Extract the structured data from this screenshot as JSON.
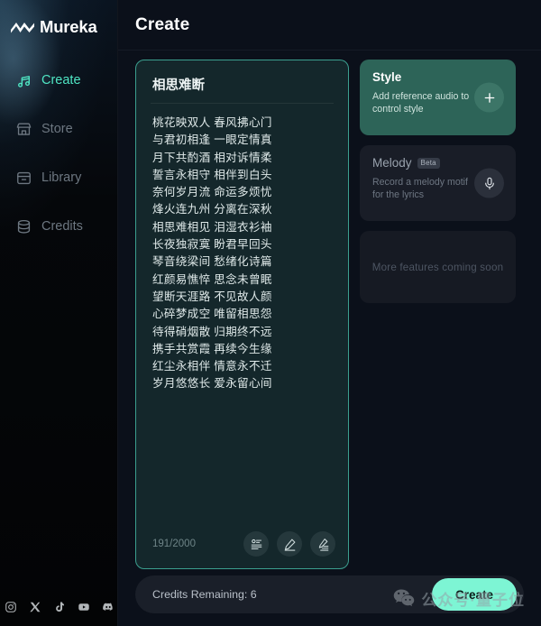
{
  "sidebar": {
    "logo": {
      "text": "Mureka",
      "icon": "wave-logo-icon"
    },
    "items": [
      {
        "label": "Create",
        "icon": "music-note-icon",
        "active": true
      },
      {
        "label": "Store",
        "icon": "storefront-icon",
        "active": false
      },
      {
        "label": "Library",
        "icon": "archive-box-icon",
        "active": false
      },
      {
        "label": "Credits",
        "icon": "database-coins-icon",
        "active": false
      }
    ],
    "socials": [
      {
        "name": "instagram-icon"
      },
      {
        "name": "x-twitter-icon"
      },
      {
        "name": "tiktok-icon"
      },
      {
        "name": "youtube-icon"
      },
      {
        "name": "discord-icon"
      }
    ]
  },
  "header": {
    "title": "Create"
  },
  "lyrics": {
    "title": "相思难断",
    "lines": [
      "桃花映双人 春风拂心门",
      "与君初相逢 一眼定情真",
      "月下共酌酒 相对诉情柔",
      "誓言永相守 相伴到白头",
      "奈何岁月流 命运多烦忧",
      "烽火连九州 分离在深秋",
      "相思难相见 泪湿衣衫袖",
      "长夜独寂寞 盼君早回头",
      "琴音绕梁间 愁绪化诗篇",
      "红颜易憔悴 思念未曾眠",
      "望断天涯路 不见故人颜",
      "心碎梦成空 唯留相思怨",
      "待得硝烟散 归期终不远",
      "携手共赏霞 再续今生缘",
      "红尘永相伴 情意永不迁",
      "岁月悠悠长 爱永留心间"
    ],
    "char_count": "191/2000",
    "buttons": [
      {
        "name": "lyrics-template-button",
        "icon": "lyric-sheet-icon"
      },
      {
        "name": "edit-lyrics-button",
        "icon": "pencil-icon"
      },
      {
        "name": "rewrite-lyrics-button",
        "icon": "pencil-lines-icon"
      }
    ]
  },
  "panels": {
    "style": {
      "title": "Style",
      "subtitle": "Add reference audio to control style",
      "action_icon": "plus-icon",
      "color": "#2d6458"
    },
    "melody": {
      "title": "Melody",
      "badge": "Beta",
      "subtitle": "Record a melody motif for the lyrics",
      "action_icon": "microphone-icon",
      "color": "#191d27"
    },
    "coming_soon": {
      "text": "More features coming soon"
    }
  },
  "bottom_bar": {
    "credits_text": "Credits Remaining: 6",
    "create_label": "Create",
    "accent": "#7df5d4"
  },
  "watermark": {
    "text": "公众号·量子位",
    "icon": "wechat-icon"
  }
}
